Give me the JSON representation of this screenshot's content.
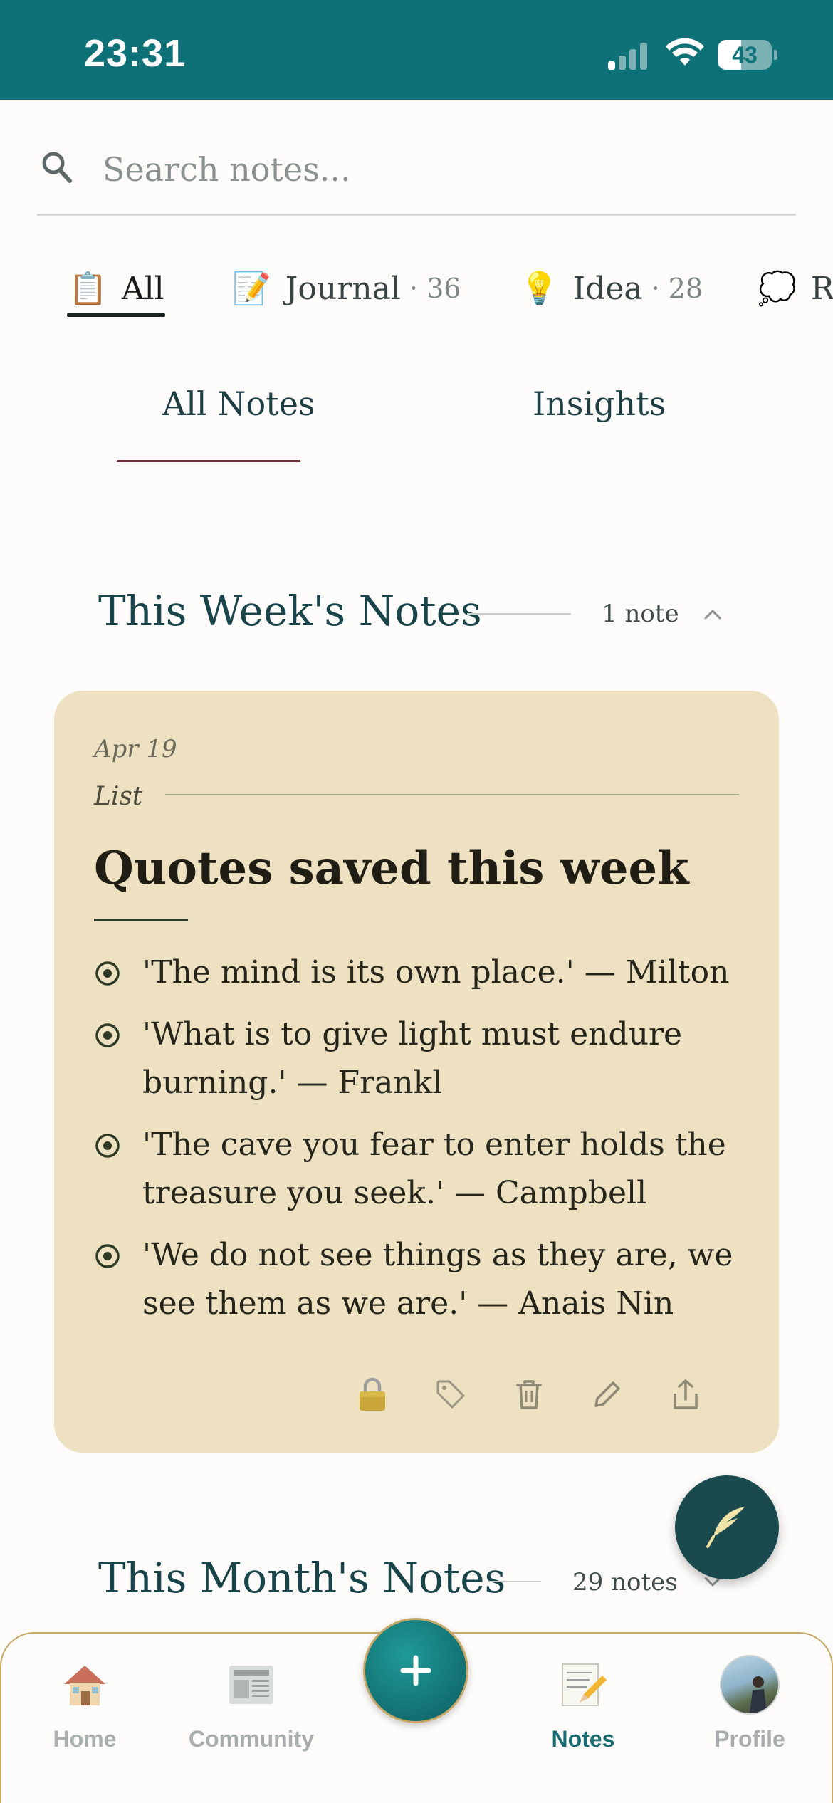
{
  "status": {
    "time": "23:31",
    "battery": "43",
    "battery_fraction": 0.43
  },
  "search": {
    "placeholder": "Search notes..."
  },
  "categories": [
    {
      "emoji": "📋",
      "label": "All",
      "count": ""
    },
    {
      "emoji": "📝",
      "label": "Journal",
      "count": "· 36"
    },
    {
      "emoji": "💡",
      "label": "Idea",
      "count": "· 28"
    },
    {
      "emoji": "💭",
      "label": "R",
      "count": ""
    }
  ],
  "tabs": [
    {
      "label": "All Notes"
    },
    {
      "label": "Insights"
    }
  ],
  "week_section": {
    "title": "This Week's Notes",
    "count": "1 note"
  },
  "note": {
    "date": "Apr 19",
    "type": "List",
    "title": "Quotes saved this week",
    "items": [
      "'The mind is its own place.' — Milton",
      "'What is to give light must endure burning.' — Frankl",
      "'The cave you fear to enter holds the treasure you seek.' — Campbell",
      "'We do not see things as they are, we see them as we are.' — Anais Nin"
    ],
    "actions": [
      "lock-icon",
      "tag-icon",
      "trash-icon",
      "edit-icon",
      "share-icon"
    ]
  },
  "month_section": {
    "title": "This Month's Notes",
    "count": "29 notes"
  },
  "nav": {
    "home": "Home",
    "community": "Community",
    "notes": "Notes",
    "profile": "Profile"
  },
  "colors": {
    "accent": "#0f7178",
    "card": "#ede1c1",
    "tab_underline": "#7a3038"
  }
}
